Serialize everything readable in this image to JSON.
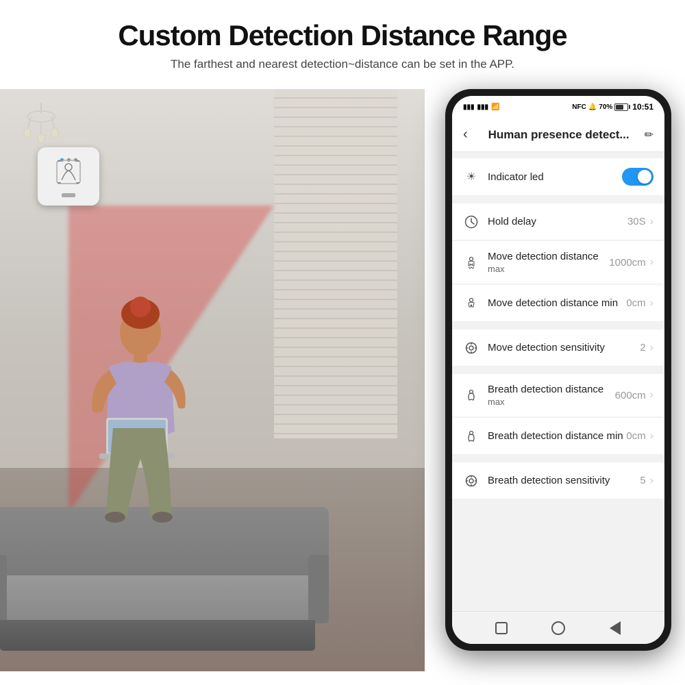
{
  "header": {
    "title": "Custom Detection Distance Range",
    "subtitle": "The farthest and nearest detection~distance can be set in the APP."
  },
  "phone": {
    "status_bar": {
      "left_icons": "📶",
      "time": "10:51",
      "battery": "70%",
      "nfc": "NFC"
    },
    "nav": {
      "title": "Human presence detect...",
      "back_label": "<",
      "edit_label": "✏"
    },
    "settings": [
      {
        "icon": "☀",
        "label": "Indicator led",
        "sublabel": "",
        "value": "",
        "type": "toggle",
        "toggle_on": true
      },
      {
        "icon": "🕐",
        "label": "Hold delay",
        "sublabel": "",
        "value": "30S",
        "type": "chevron"
      },
      {
        "icon": "🏃",
        "label": "Move detection distance",
        "sublabel": "max",
        "value": "1000cm",
        "type": "chevron"
      },
      {
        "icon": "🚶",
        "label": "Move detection distance min",
        "sublabel": "",
        "value": "0cm",
        "type": "chevron"
      },
      {
        "icon": "⚙",
        "label": "Move detection sensitivity",
        "sublabel": "",
        "value": "2",
        "type": "chevron"
      },
      {
        "icon": "👤",
        "label": "Breath detection distance",
        "sublabel": "max",
        "value": "600cm",
        "type": "chevron"
      },
      {
        "icon": "👤",
        "label": "Breath detection distance min",
        "sublabel": "",
        "value": "0cm",
        "type": "chevron"
      },
      {
        "icon": "⚙",
        "label": "Breath detection sensitivity",
        "sublabel": "",
        "value": "5",
        "type": "chevron"
      }
    ],
    "bottom_nav": {
      "square": "□",
      "circle": "○",
      "triangle": "△"
    }
  },
  "icons": {
    "sun": "☀",
    "clock": "⏰",
    "running": "🏃",
    "walking": "🚶",
    "gear": "⚙",
    "person": "👤"
  },
  "colors": {
    "toggle_on": "#2196F3",
    "accent": "#2196F3",
    "text_primary": "#222222",
    "text_secondary": "#999999",
    "bg_page": "#ffffff",
    "phone_body": "#1a1a1a"
  }
}
